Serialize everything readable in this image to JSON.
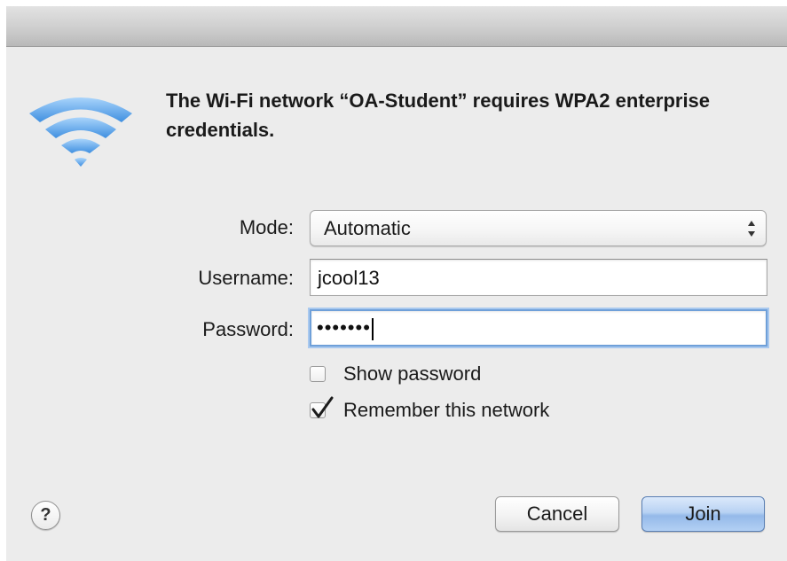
{
  "dialog": {
    "message": "The Wi-Fi network “OA-Student” requires WPA2 enterprise credentials.",
    "icon": "wifi-icon"
  },
  "form": {
    "mode_label": "Mode:",
    "mode_value": "Automatic",
    "username_label": "Username:",
    "username_value": "jcool13",
    "password_label": "Password:",
    "password_mask": "•••••••"
  },
  "options": {
    "show_password_label": "Show password",
    "show_password_checked": false,
    "remember_label": "Remember this network",
    "remember_checked": true
  },
  "buttons": {
    "help_label": "?",
    "cancel_label": "Cancel",
    "join_label": "Join",
    "default_button_color": "#94b9e9"
  },
  "colors": {
    "wifi_blue": "#4a9be8",
    "focus_ring": "#6fa0d9"
  }
}
